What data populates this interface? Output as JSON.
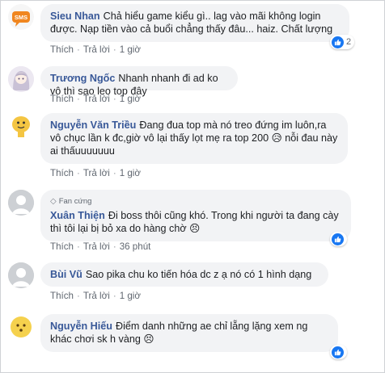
{
  "actions": {
    "like": "Thích",
    "reply": "Trả lời"
  },
  "comments": [
    {
      "name": "Sieu Nhan",
      "text": "Chả hiểu game kiểu gì.. lag vào mãi không login được. Nạp tiền vào cả buổi chẳng thấy đâu... haiz. Chất lượng",
      "time": "1 giờ",
      "reactions": "2",
      "avatar_text": "SMS"
    },
    {
      "name": "Trương Ngốc",
      "text": "Nhanh nhanh đi ad ko vô thì sao leo top đây",
      "time": "1 giờ"
    },
    {
      "name": "Nguyễn Văn Triều",
      "text": "Đang đua top mà nó treo đứng im luôn,ra vô chục lần k đc,giờ vô lại thấy lọt mẹ ra top 200",
      "text2": "nỗi đau này ai thấuuuuuuu",
      "time": "1 giờ"
    },
    {
      "badge": "Fan cứng",
      "name": "Xuân Thiện",
      "text": "Đi boss thôi cũng khó. Trong khi người ta đang cày thì tôi lại bị bỏ xa do hàng chờ",
      "time": "36 phút",
      "reactions": ""
    },
    {
      "name": "Bùi Vũ",
      "text": "Sao pika chu ko tiến hóa dc z ạ nó có 1 hình dạng",
      "time": "1 giờ"
    },
    {
      "name": "Nguyễn Hiếu",
      "text": "Điểm danh những ae chỉ lẵng lặng xem ng khác chơi sk h vàng",
      "time": "",
      "reactions": ""
    }
  ],
  "colors": {
    "name": "#385898",
    "bubble": "#f2f3f5",
    "like": "#1877f2"
  }
}
